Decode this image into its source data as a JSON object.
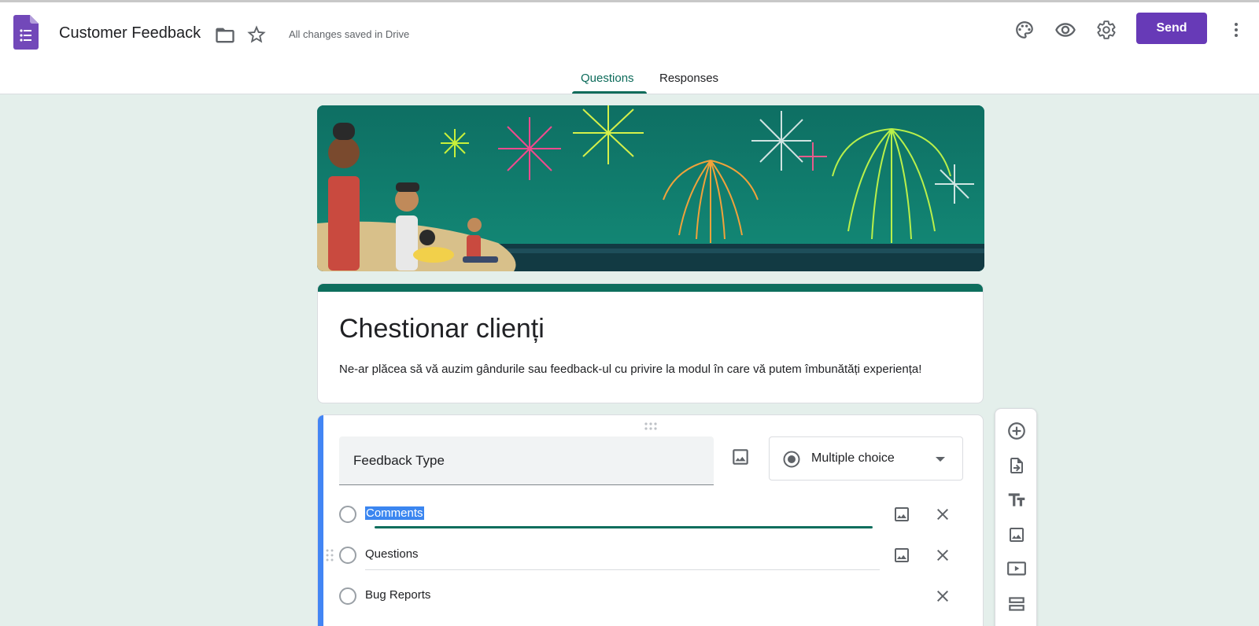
{
  "header": {
    "doc_title": "Customer Feedback",
    "save_status": "All changes saved in Drive",
    "send_label": "Send"
  },
  "tabs": [
    {
      "label": "Questions",
      "active": true
    },
    {
      "label": "Responses",
      "active": false
    }
  ],
  "form": {
    "title": "Chestionar clienți",
    "description": "Ne-ar plăcea să vă auzim gândurile sau feedback-ul cu privire la modul în care vă putem îmbunătăți experiența!"
  },
  "question": {
    "title": "Feedback Type",
    "type": "Multiple choice",
    "options": [
      {
        "label": "Comments",
        "selected": true
      },
      {
        "label": "Questions",
        "selected": false
      },
      {
        "label": "Bug Reports",
        "selected": false
      }
    ]
  },
  "colors": {
    "accent": "#673ab7",
    "theme": "#0d6e5d",
    "selection": "#3b86f0",
    "background": "#e4efeb"
  },
  "icons": [
    "forms-logo-icon",
    "folder-icon",
    "star-icon",
    "palette-icon",
    "preview-eye-icon",
    "settings-gear-icon",
    "more-vert-icon",
    "image-icon",
    "close-icon",
    "drag-handle-icon",
    "add-circle-icon",
    "import-questions-icon",
    "title-text-icon",
    "add-image-icon",
    "add-video-icon",
    "add-section-icon"
  ]
}
